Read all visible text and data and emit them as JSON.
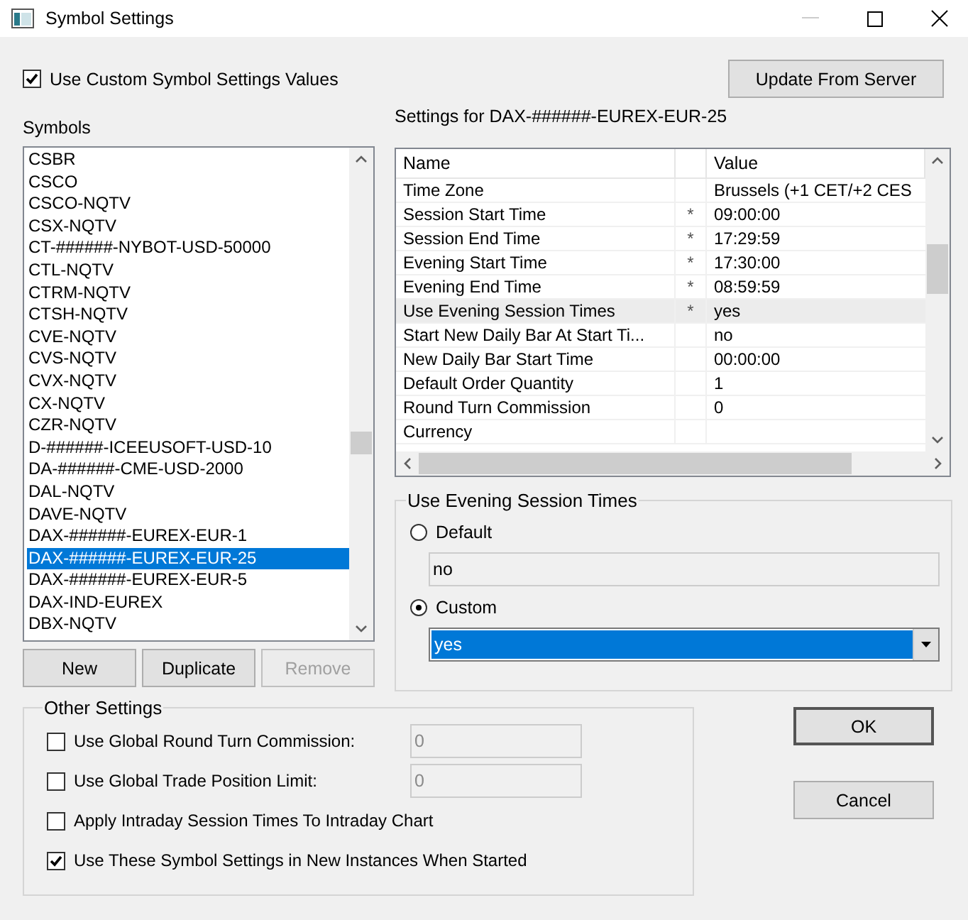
{
  "window": {
    "title": "Symbol Settings"
  },
  "use_custom": {
    "label": "Use Custom Symbol Settings Values",
    "checked": true
  },
  "update_button": "Update From Server",
  "symbols": {
    "label": "Symbols",
    "items": [
      {
        "label": "CSBR",
        "selected": false
      },
      {
        "label": "CSCO",
        "selected": false
      },
      {
        "label": "CSCO-NQTV",
        "selected": false
      },
      {
        "label": "CSX-NQTV",
        "selected": false
      },
      {
        "label": "CT-######-NYBOT-USD-50000",
        "selected": false
      },
      {
        "label": "CTL-NQTV",
        "selected": false
      },
      {
        "label": "CTRM-NQTV",
        "selected": false
      },
      {
        "label": "CTSH-NQTV",
        "selected": false
      },
      {
        "label": "CVE-NQTV",
        "selected": false
      },
      {
        "label": "CVS-NQTV",
        "selected": false
      },
      {
        "label": "CVX-NQTV",
        "selected": false
      },
      {
        "label": "CX-NQTV",
        "selected": false
      },
      {
        "label": "CZR-NQTV",
        "selected": false
      },
      {
        "label": "D-######-ICEEUSOFT-USD-10",
        "selected": false
      },
      {
        "label": "DA-######-CME-USD-2000",
        "selected": false
      },
      {
        "label": "DAL-NQTV",
        "selected": false
      },
      {
        "label": "DAVE-NQTV",
        "selected": false
      },
      {
        "label": "DAX-######-EUREX-EUR-1",
        "selected": false
      },
      {
        "label": "DAX-######-EUREX-EUR-25",
        "selected": true
      },
      {
        "label": "DAX-######-EUREX-EUR-5",
        "selected": false
      },
      {
        "label": "DAX-IND-EUREX",
        "selected": false
      },
      {
        "label": "DBX-NQTV",
        "selected": false
      }
    ]
  },
  "list_buttons": [
    {
      "label": "New",
      "disabled": false
    },
    {
      "label": "Duplicate",
      "disabled": false
    },
    {
      "label": "Remove",
      "disabled": true
    }
  ],
  "settings_title": "Settings for DAX-######-EUREX-EUR-25",
  "table": {
    "columns": [
      "Name",
      "Value"
    ],
    "rows": [
      {
        "name": "Time Zone",
        "value": "Brussels (+1 CET/+2 CES",
        "selected": false
      },
      {
        "name": "Session Start Time",
        "marker": "*",
        "value": "09:00:00",
        "selected": false
      },
      {
        "name": "Session End Time",
        "marker": "*",
        "value": "17:29:59",
        "selected": false
      },
      {
        "name": "Evening Start Time",
        "marker": "*",
        "value": "17:30:00",
        "selected": false
      },
      {
        "name": "Evening End Time",
        "marker": "*",
        "value": "08:59:59",
        "selected": false
      },
      {
        "name": "Use Evening Session Times",
        "marker": "*",
        "value": "yes",
        "selected": true
      },
      {
        "name": "Start New Daily Bar At Start Ti...",
        "value": "no",
        "selected": false
      },
      {
        "name": "New Daily Bar Start Time",
        "value": "00:00:00",
        "selected": false
      },
      {
        "name": "Default Order Quantity",
        "value": "1",
        "selected": false
      },
      {
        "name": "Round Turn Commission",
        "value": "0",
        "selected": false
      },
      {
        "name": "Currency",
        "selected": false
      }
    ]
  },
  "evening_group": {
    "title": "Use Evening Session Times",
    "options": [
      {
        "label": "Default",
        "selected": false,
        "kind": "field",
        "value": "no"
      },
      {
        "label": "Custom",
        "selected": true,
        "kind": "dropdown",
        "value": "yes"
      }
    ]
  },
  "other_settings": {
    "title": "Other Settings",
    "items": [
      {
        "label": "Use Global Round Turn Commission:",
        "checked": false,
        "field": "0"
      },
      {
        "label": "Use Global Trade Position Limit:",
        "checked": false,
        "field": "0"
      },
      {
        "label": "Apply Intraday Session Times To Intraday Chart",
        "checked": false
      },
      {
        "label": "Use These Symbol Settings in New Instances When Started",
        "checked": true
      }
    ]
  },
  "dialog_buttons": [
    "OK",
    "Cancel"
  ]
}
